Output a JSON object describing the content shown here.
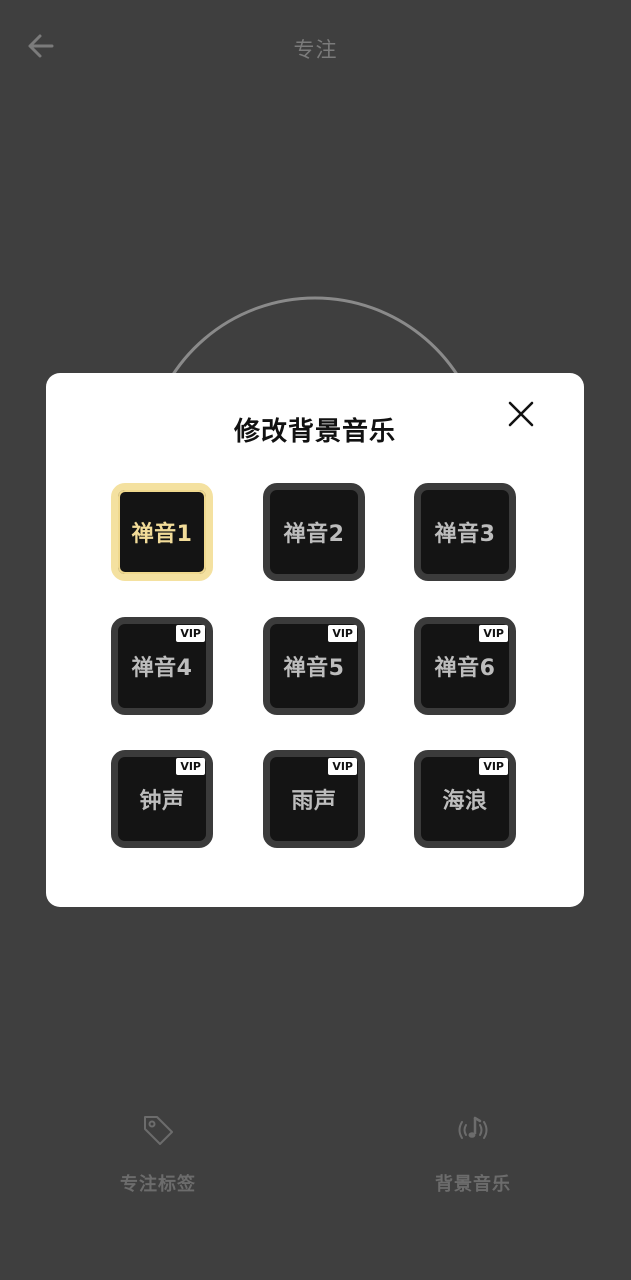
{
  "header": {
    "title": "专注",
    "back_icon": "arrow-left-icon"
  },
  "toolbar": {
    "tag_label": "专注标签",
    "tag_icon": "tag-icon",
    "music_label": "背景音乐",
    "music_icon": "music-note-icon"
  },
  "modal": {
    "title": "修改背景音乐",
    "close_icon": "close-icon",
    "tracks": [
      {
        "label": "禅音1",
        "vip": "",
        "selected": true
      },
      {
        "label": "禅音2",
        "vip": "",
        "selected": false
      },
      {
        "label": "禅音3",
        "vip": "",
        "selected": false
      },
      {
        "label": "禅音4",
        "vip": "VIP",
        "selected": false
      },
      {
        "label": "禅音5",
        "vip": "VIP",
        "selected": false
      },
      {
        "label": "禅音6",
        "vip": "VIP",
        "selected": false
      },
      {
        "label": "钟声",
        "vip": "VIP",
        "selected": false
      },
      {
        "label": "雨声",
        "vip": "VIP",
        "selected": false
      },
      {
        "label": "海浪",
        "vip": "VIP",
        "selected": false
      }
    ]
  },
  "colors": {
    "background": "#3f3f3f",
    "modal": "#ffffff",
    "tile_fill": "#141414",
    "tile_border": "#3b3b3b",
    "selected_accent": "#f2dc99"
  }
}
